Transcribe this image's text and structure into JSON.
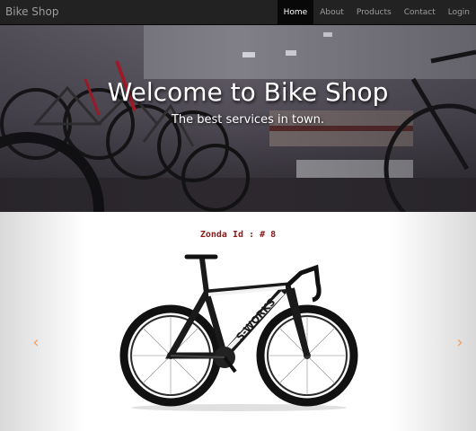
{
  "navbar": {
    "brand": "Bike Shop",
    "items": [
      {
        "label": "Home",
        "active": true
      },
      {
        "label": "About",
        "active": false
      },
      {
        "label": "Products",
        "active": false
      },
      {
        "label": "Contact",
        "active": false
      },
      {
        "label": "Login",
        "active": false
      }
    ]
  },
  "hero": {
    "title": "Welcome to Bike Shop",
    "subtitle": "The best services in town."
  },
  "carousel": {
    "product_id": "Zonda Id : # 8",
    "prev_icon": "chevron-left-icon",
    "next_icon": "chevron-right-icon",
    "bike_brand_text": "S-WORKS",
    "prev_glyph": "‹",
    "next_glyph": "›"
  },
  "colors": {
    "navbar_bg": "#222222",
    "active_bg": "#080808",
    "product_id": "#8b1a1a",
    "arrow": "#f0a060"
  }
}
